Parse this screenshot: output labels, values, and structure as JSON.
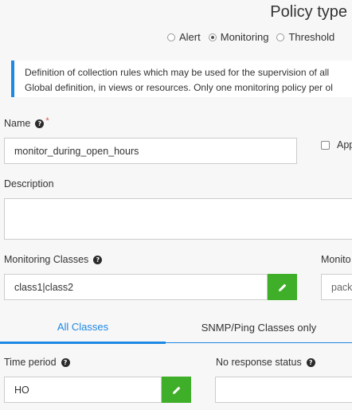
{
  "header": {
    "title": "Policy type"
  },
  "policy_type": {
    "options": [
      {
        "label": "Alert",
        "checked": false
      },
      {
        "label": "Monitoring",
        "checked": true
      },
      {
        "label": "Threshold",
        "checked": false
      }
    ]
  },
  "info": {
    "line1": "Definition of collection rules which may be used for the supervision of all",
    "line2": "Global definition, in views or resources. Only one monitoring policy per ol"
  },
  "name": {
    "label": "Name",
    "help": "?",
    "required_mark": "*",
    "value": "monitor_during_open_hours"
  },
  "apply_checkbox": {
    "label": "App"
  },
  "description": {
    "label": "Description",
    "value": ""
  },
  "monitoring_classes": {
    "label": "Monitoring Classes",
    "help": "?",
    "value": "class1|class2"
  },
  "monitoring_right": {
    "label": "Monito",
    "value": "pack"
  },
  "tabs": [
    {
      "label": "All Classes",
      "active": true
    },
    {
      "label": "SNMP/Ping Classes only",
      "active": false
    }
  ],
  "time_period": {
    "label": "Time period",
    "help": "?",
    "value": "HO"
  },
  "no_response_status": {
    "label": "No response status",
    "help": "?",
    "value": ""
  },
  "colors": {
    "accent": "#1e88e5",
    "edit_button": "#3fae29",
    "required": "#d9534f"
  },
  "icons": {
    "edit": "pencil-icon",
    "help": "question-circle-icon"
  }
}
